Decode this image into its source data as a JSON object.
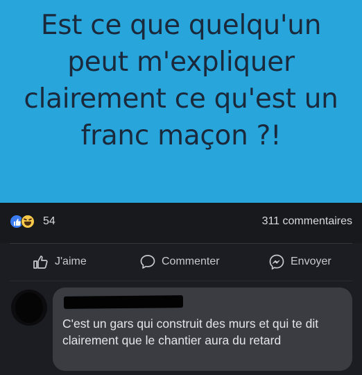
{
  "post": {
    "lines": [
      "Est ce que quelqu'un",
      "peut m'expliquer",
      "clairement ce qu'est un",
      "franc maçon ?!"
    ],
    "background_color": "#28a6dc"
  },
  "reactions": {
    "icons": [
      "like-icon",
      "haha-icon"
    ],
    "count": "54",
    "comments": "311 commentaires"
  },
  "actions": {
    "like": "J'aime",
    "comment": "Commenter",
    "send": "Envoyer"
  },
  "comment": {
    "text": "C'est un gars qui construit des murs et qui te dit clairement que le chantier aura du retard"
  }
}
